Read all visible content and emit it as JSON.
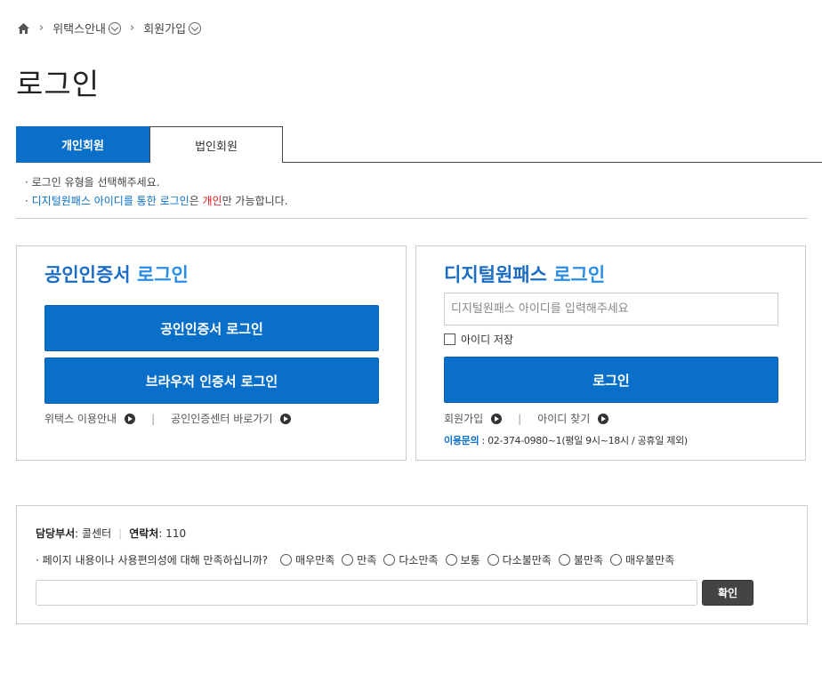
{
  "breadcrumb": {
    "home_icon": "home-icon",
    "items": [
      {
        "label": "위택스안내"
      },
      {
        "label": "회원가입"
      }
    ]
  },
  "page": {
    "title": "로그인"
  },
  "tabs": [
    {
      "label": "개인회원",
      "active": true
    },
    {
      "label": "법인회원",
      "active": false
    }
  ],
  "notice": {
    "line1": "· 로그인 유형을 선택해주세요.",
    "line2_prefix": "· ",
    "line2_blue": "디지털원패스 아이디를 통한 로그인",
    "line2_mid": "은 ",
    "line2_red": "개인",
    "line2_suffix": "만 가능합니다."
  },
  "cert": {
    "title_a": "공인인증서",
    "title_b": " 로그인",
    "btn_cert": "공인인증서 로그인",
    "btn_browser": "브라우저 인증서 로그인",
    "link_guide": "위택스 이용안내",
    "link_center": "공인인증센터 바로가기"
  },
  "digitalpass": {
    "title_a": "디지털원패스",
    "title_b": " 로그인",
    "id_placeholder": "디지털원패스 아이디를 입력해주세요",
    "save_id": "아이디 저장",
    "btn_login": "로그인",
    "link_join": "회원가입",
    "link_find": "아이디 찾기",
    "contact_label": "이용문의",
    "contact_text": " : 02-374-0980~1(평일 9시~18시 / 공휴일 제외)"
  },
  "survey": {
    "dept_label": "담당부서",
    "dept_value": " : 콜센터",
    "contact_label": "연락처",
    "contact_value": " : 110",
    "question": "·  페이지 내용이나 사용편의성에 대해 만족하십니까?",
    "options": [
      "매우만족",
      "만족",
      "다소만족",
      "보통",
      "다소불만족",
      "불만족",
      "매우불만족"
    ],
    "confirm": "확인"
  },
  "colors": {
    "primary": "#0a6fc9",
    "accent_red": "#e01818",
    "dark_button": "#444444"
  }
}
